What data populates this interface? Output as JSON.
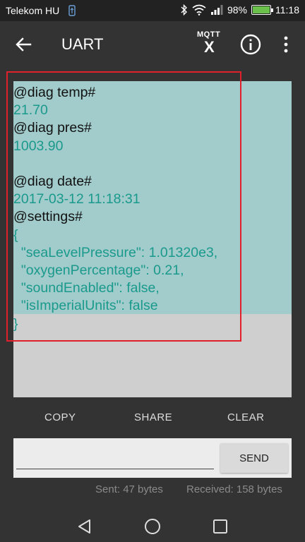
{
  "status_bar": {
    "carrier": "Telekom HU",
    "battery": "98%",
    "time": "11:18",
    "icons": [
      "usb-icon",
      "bluetooth-icon",
      "wifi-icon",
      "signal-icon",
      "battery-icon"
    ]
  },
  "app_bar": {
    "title": "UART",
    "mqtt_top": "MQTT",
    "mqtt_x": "X",
    "icons": [
      "back-arrow-icon",
      "mqtt-icon",
      "info-icon",
      "more-vert-icon"
    ]
  },
  "output": {
    "lines": [
      {
        "text": "@diag temp#",
        "kind": "cmd"
      },
      {
        "text": "21.70",
        "kind": "resp"
      },
      {
        "text": "@diag pres#",
        "kind": "cmd"
      },
      {
        "text": "1003.90",
        "kind": "resp"
      },
      {
        "text": "",
        "kind": "resp"
      },
      {
        "text": "@diag date#",
        "kind": "cmd"
      },
      {
        "text": "2017-03-12 11:18:31",
        "kind": "resp"
      },
      {
        "text": "@settings#",
        "kind": "cmd"
      },
      {
        "text": "{",
        "kind": "resp"
      },
      {
        "text": "  \"seaLevelPressure\": 1.01320e3,",
        "kind": "resp"
      },
      {
        "text": "  \"oxygenPercentage\": 0.21,",
        "kind": "resp"
      },
      {
        "text": "  \"soundEnabled\": false,",
        "kind": "resp"
      },
      {
        "text": "  \"isImperialUnits\": false",
        "kind": "resp"
      },
      {
        "text": "}",
        "kind": "resp"
      }
    ]
  },
  "actions": {
    "copy": "COPY",
    "share": "SHARE",
    "clear": "CLEAR"
  },
  "input": {
    "value": "",
    "placeholder": "",
    "send_label": "SEND"
  },
  "counters": {
    "sent": "Sent: 47 bytes",
    "received": "Received: 158 bytes"
  },
  "colors": {
    "output_bg": "#a2cbcb",
    "command_text": "#111111",
    "response_text": "#1a9a8c",
    "highlight": "#e0202a"
  },
  "nav_bar": {
    "icons": [
      "back-triangle-icon",
      "home-circle-icon",
      "recents-square-icon"
    ]
  }
}
